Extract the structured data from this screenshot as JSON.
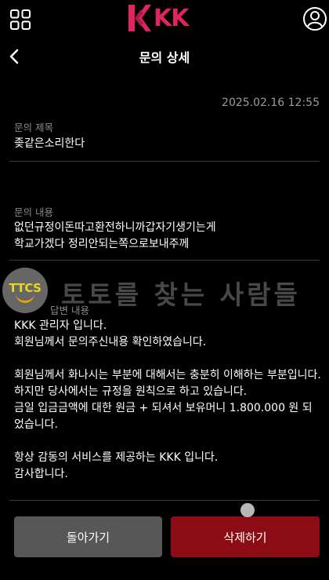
{
  "brand": {
    "logo_text": "KK",
    "accent_color": "#e0245e"
  },
  "header": {
    "title": "문의 상세",
    "back_icon": "chevron-left"
  },
  "inquiry": {
    "date": "2025.02.16 12:55",
    "subject_label": "문의 제목",
    "subject_value": "좆같은소리한다",
    "content_label": "문의 내용",
    "content_lines": [
      "없던규정이돈따고환전하니까갑자기생기는게",
      "학교가겠다 정리안되는쪽으로보내주께"
    ]
  },
  "reply": {
    "label_partial": "답변 내용",
    "lines": [
      "KKK 관리자 입니다.",
      "회원님께서 문의주신내용 확인하였습니다.",
      "",
      "회원님께서 화나시는 부분에 대해서는 충분히 이해하는 부분입니다.",
      "하지만 당사에서는 규정을 원칙으로 하고 있습니다.",
      "금일 입금금액에 대한 원금 + 되셔서 보유머니 1.800.000 원 되었습니다.",
      "",
      "항상 감동의 서비스를 제공하는 KKK 입니다.",
      "감사합니다."
    ]
  },
  "watermark": {
    "badge": "TTCS",
    "text": "토토를 찾는 사람들"
  },
  "buttons": {
    "back_label": "돌아가기",
    "delete_label": "삭제하기",
    "delete_color": "#8b0c14"
  }
}
